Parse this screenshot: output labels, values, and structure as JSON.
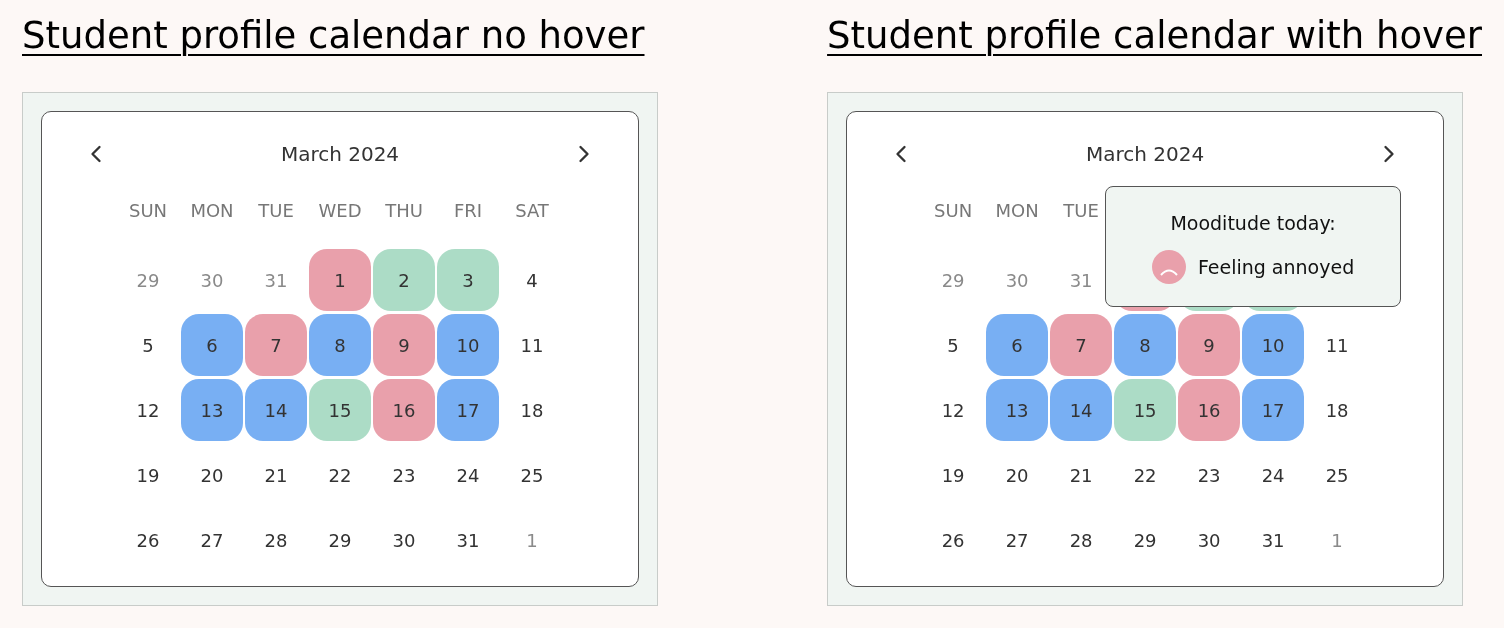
{
  "panels": [
    {
      "title": "Student profile calendar no hover",
      "month": "March 2024",
      "weekdays": [
        "SUN",
        "MON",
        "TUE",
        "WED",
        "THU",
        "FRI",
        "SAT"
      ],
      "weeks": [
        [
          {
            "label": "29",
            "muted": true
          },
          {
            "label": "30",
            "muted": true
          },
          {
            "label": "31",
            "muted": true
          },
          {
            "label": "1",
            "color": "#e9a0ab"
          },
          {
            "label": "2",
            "color": "#acdcc6"
          },
          {
            "label": "3",
            "color": "#acdcc6"
          },
          {
            "label": "4"
          }
        ],
        [
          {
            "label": "5"
          },
          {
            "label": "6",
            "color": "#78aff3"
          },
          {
            "label": "7",
            "color": "#e9a0ab"
          },
          {
            "label": "8",
            "color": "#78aff3"
          },
          {
            "label": "9",
            "color": "#e9a0ab"
          },
          {
            "label": "10",
            "color": "#78aff3"
          },
          {
            "label": "11"
          }
        ],
        [
          {
            "label": "12"
          },
          {
            "label": "13",
            "color": "#78aff3"
          },
          {
            "label": "14",
            "color": "#78aff3"
          },
          {
            "label": "15",
            "color": "#acdcc6"
          },
          {
            "label": "16",
            "color": "#e9a0ab"
          },
          {
            "label": "17",
            "color": "#78aff3"
          },
          {
            "label": "18"
          }
        ],
        [
          {
            "label": "19"
          },
          {
            "label": "20"
          },
          {
            "label": "21"
          },
          {
            "label": "22"
          },
          {
            "label": "23"
          },
          {
            "label": "24"
          },
          {
            "label": "25"
          }
        ],
        [
          {
            "label": "26"
          },
          {
            "label": "27"
          },
          {
            "label": "28"
          },
          {
            "label": "29"
          },
          {
            "label": "30"
          },
          {
            "label": "31"
          },
          {
            "label": "1",
            "muted": true
          }
        ]
      ]
    },
    {
      "title": "Student profile calendar with hover",
      "month": "March 2024",
      "weekdays": [
        "SUN",
        "MON",
        "TUE"
      ],
      "weeks": [
        [
          {
            "label": "29",
            "muted": true
          },
          {
            "label": "30",
            "muted": true
          },
          {
            "label": "31",
            "muted": true
          },
          {
            "color": "#e9a0ab"
          },
          {
            "color": "#acdcc6"
          },
          {
            "color": "#acdcc6"
          }
        ],
        [
          {
            "label": "5"
          },
          {
            "label": "6",
            "color": "#78aff3"
          },
          {
            "label": "7",
            "color": "#e9a0ab"
          },
          {
            "label": "8",
            "color": "#78aff3"
          },
          {
            "label": "9",
            "color": "#e9a0ab"
          },
          {
            "label": "10",
            "color": "#78aff3"
          },
          {
            "label": "11"
          }
        ],
        [
          {
            "label": "12"
          },
          {
            "label": "13",
            "color": "#78aff3"
          },
          {
            "label": "14",
            "color": "#78aff3"
          },
          {
            "label": "15",
            "color": "#acdcc6"
          },
          {
            "label": "16",
            "color": "#e9a0ab"
          },
          {
            "label": "17",
            "color": "#78aff3"
          },
          {
            "label": "18"
          }
        ],
        [
          {
            "label": "19"
          },
          {
            "label": "20"
          },
          {
            "label": "21"
          },
          {
            "label": "22"
          },
          {
            "label": "23"
          },
          {
            "label": "24"
          },
          {
            "label": "25"
          }
        ],
        [
          {
            "label": "26"
          },
          {
            "label": "27"
          },
          {
            "label": "28"
          },
          {
            "label": "29"
          },
          {
            "label": "30"
          },
          {
            "label": "31"
          },
          {
            "label": "1",
            "muted": true
          }
        ]
      ],
      "tooltip": {
        "title": "Mooditude today:",
        "mood": "Feeling annoyed",
        "color": "#e9a0ab"
      }
    }
  ]
}
